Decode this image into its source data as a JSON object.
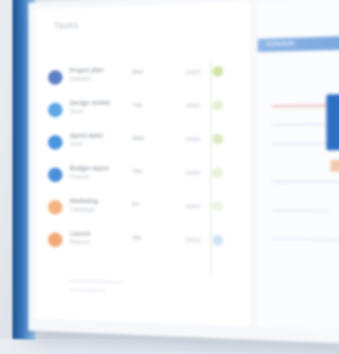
{
  "panel": {
    "title": "Tasks"
  },
  "rows": [
    {
      "name": "Project plan",
      "meta": "Updated",
      "col1": "Mon",
      "col2": "12",
      "avatar_color": "#5f7fc4",
      "dot_color": "#cfe4a6"
    },
    {
      "name": "Design review",
      "meta": "Team",
      "col1": "Tue",
      "col2": "08",
      "avatar_color": "#5fa6e6",
      "dot_color": "#e8f0d8"
    },
    {
      "name": "Sprint tasks",
      "meta": "Team",
      "col1": "Wed",
      "col2": "05",
      "avatar_color": "#4a93df",
      "dot_color": "#dcebc0"
    },
    {
      "name": "Budget report",
      "meta": "Finance",
      "col1": "Thu",
      "col2": "03",
      "avatar_color": "#4c8fd9",
      "dot_color": "#e9f2dc"
    },
    {
      "name": "Marketing",
      "meta": "Campaign",
      "col1": "Fri",
      "col2": "09",
      "avatar_color": "#f4b382",
      "dot_color": "#eef4e6"
    },
    {
      "name": "Launch",
      "meta": "Release",
      "col1": "Sat",
      "col2": "02",
      "avatar_color": "#f2a874",
      "dot_color": "#cfe3f5"
    }
  ],
  "right": {
    "header": "Schedule"
  },
  "footer": {
    "text": ""
  }
}
